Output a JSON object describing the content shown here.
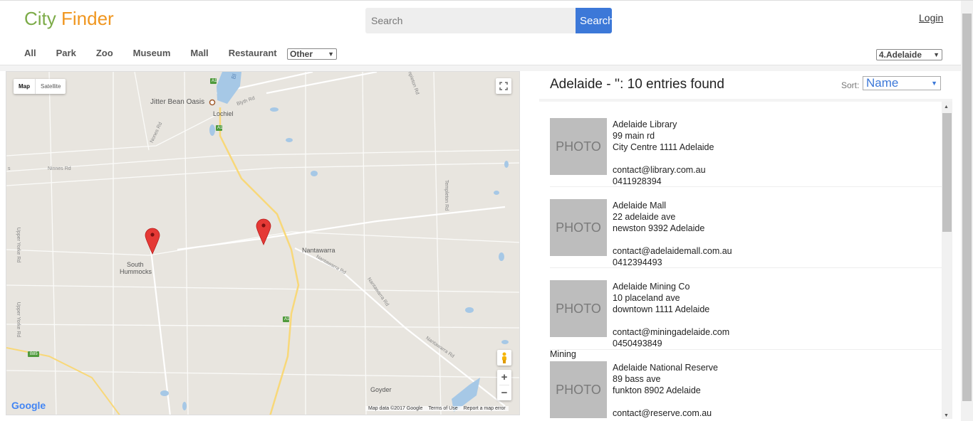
{
  "header": {
    "logo_part1": "City",
    "logo_part2": "Finder",
    "search_placeholder": "Search",
    "search_button": "Search",
    "login": "Login"
  },
  "categories": [
    "All",
    "Park",
    "Zoo",
    "Museum",
    "Mall",
    "Restaurant"
  ],
  "other_select": "Other",
  "city_select": "4.Adelaide",
  "map": {
    "type_map": "Map",
    "type_satellite": "Satellite",
    "labels": {
      "jitter_bean": "Jitter Bean Oasis",
      "lochiel": "Lochiel",
      "nantawarra": "Nantawarra",
      "south": "South",
      "hummocks": "Hummocks",
      "goyder": "Goyder"
    },
    "roads": {
      "nones_rd": "Nones Rd",
      "ninnes_rd": "Ninnes Rd",
      "blyth_rd": "Blyth Rd",
      "templeton_rd": "Templeton Rd",
      "templeton_rd2": "Templeton Rd",
      "nantawarra_rd": "Nantawarra Rd",
      "nantawarra_rd2": "Nantawarra Rd",
      "nantawarra_rd3": "Nantawarra Rd",
      "upper_yorke_rd": "Upper Yorke Rd",
      "upper_yorke_rd2": "Upper Yorke Rd",
      "a1_1": "A1",
      "a1_2": "A1",
      "a1_3": "A1",
      "b85": "B85",
      "partial": "Bl",
      "s": "s"
    },
    "google": "Google",
    "footer": [
      "Map data ©2017 Google",
      "Terms of Use",
      "Report a map error"
    ],
    "zoom_in": "+",
    "zoom_out": "−"
  },
  "results": {
    "title": "Adelaide - '': 10 entries found",
    "sort_label": "Sort:",
    "sort_value": "Name",
    "photo_placeholder": "PHOTO",
    "entries": [
      {
        "name": "Adelaide Library",
        "street": "99 main rd",
        "suburb": "City Centre 1111 Adelaide",
        "email": "contact@library.com.au",
        "phone": "0411928394"
      },
      {
        "name": "Adelaide Mall",
        "street": "22 adelaide ave",
        "suburb": "newston 9392 Adelaide",
        "email": "contact@adelaidemall.com.au",
        "phone": "0412394493"
      },
      {
        "name": "Adelaide Mining Co",
        "street": "10 placeland ave",
        "suburb": "downtown 1111 Adelaide",
        "email": "contact@miningadelaide.com",
        "phone": "0450493849"
      },
      {
        "name": "Adelaide National Reserve",
        "street": "89 bass ave",
        "suburb": "funkton 8902 Adelaide",
        "email": "contact@reserve.com.au",
        "phone": ""
      }
    ],
    "mining_label": "Mining"
  },
  "colors": {
    "logo_city": "#7cab48",
    "logo_finder": "#f0961f",
    "accent": "#3c78d8",
    "marker": "#e53935"
  }
}
